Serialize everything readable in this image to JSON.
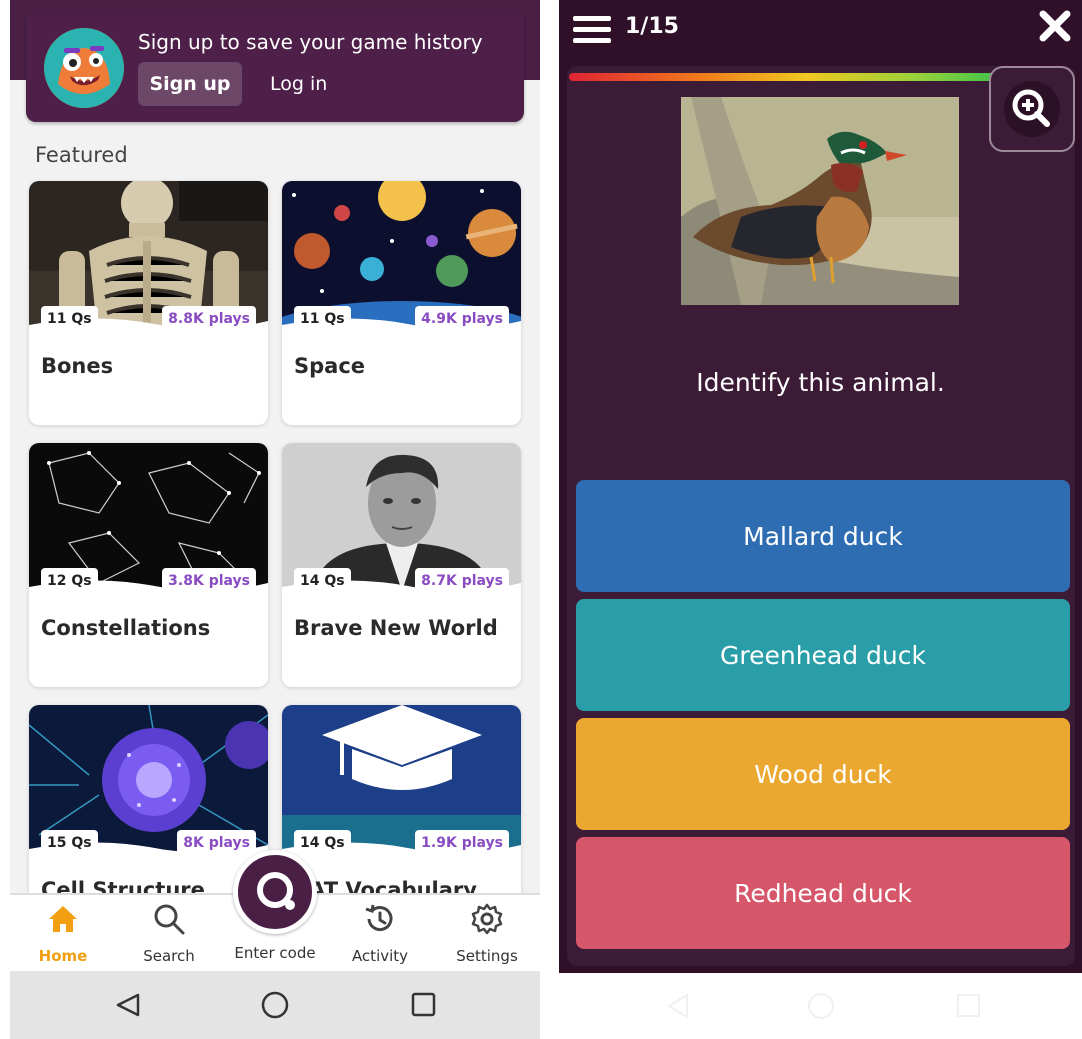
{
  "left_screen": {
    "banner": {
      "text": "Sign up to save your game history",
      "signup_label": "Sign up",
      "login_label": "Log in"
    },
    "section_title": "Featured",
    "cards": [
      {
        "title": "Bones",
        "questions": "11 Qs",
        "plays": "8.8K plays"
      },
      {
        "title": "Space",
        "questions": "11 Qs",
        "plays": "4.9K plays"
      },
      {
        "title": "Constellations",
        "questions": "12 Qs",
        "plays": "3.8K plays"
      },
      {
        "title": "Brave New World",
        "questions": "14 Qs",
        "plays": "8.7K plays"
      },
      {
        "title": "Cell Structure",
        "questions": "15 Qs",
        "plays": "8K plays"
      },
      {
        "title": "SAT Vocabulary",
        "questions": "14 Qs",
        "plays": "1.9K plays"
      }
    ],
    "nav": {
      "home": "Home",
      "search": "Search",
      "enter_code": "Enter code",
      "activity": "Activity",
      "settings": "Settings"
    },
    "colors": {
      "brand": "#4a1f45",
      "active": "#f2a012"
    }
  },
  "right_screen": {
    "counter": "1/15",
    "progress": 0.83,
    "question": "Identify this animal.",
    "answers": [
      {
        "label": "Mallard duck",
        "color": "#2f6db3"
      },
      {
        "label": "Greenhead duck",
        "color": "#2a9ea8"
      },
      {
        "label": "Wood duck",
        "color": "#eba830"
      },
      {
        "label": "Redhead duck",
        "color": "#d6566a"
      }
    ]
  }
}
